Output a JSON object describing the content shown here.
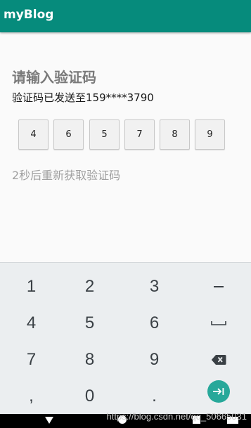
{
  "app": {
    "title": "myBlog"
  },
  "verify": {
    "heading": "请输入验证码",
    "sent_to": "验证码已发送至159****3790",
    "code_digits": [
      "4",
      "6",
      "5",
      "7",
      "8",
      "9"
    ],
    "countdown": "2秒后重新获取验证码"
  },
  "keypad": {
    "rows": [
      [
        "1",
        "2",
        "3",
        "－"
      ],
      [
        "4",
        "5",
        "6",
        "␣"
      ],
      [
        "7",
        "8",
        "9",
        "⌫"
      ],
      [
        ",",
        "0",
        ".",
        "→|"
      ]
    ]
  },
  "watermark": "https://blog.csdn.net/qq_50665031",
  "colors": {
    "appbar": "#068b7c",
    "accent": "#27a89a",
    "keypad_bg": "#ebeef0"
  }
}
